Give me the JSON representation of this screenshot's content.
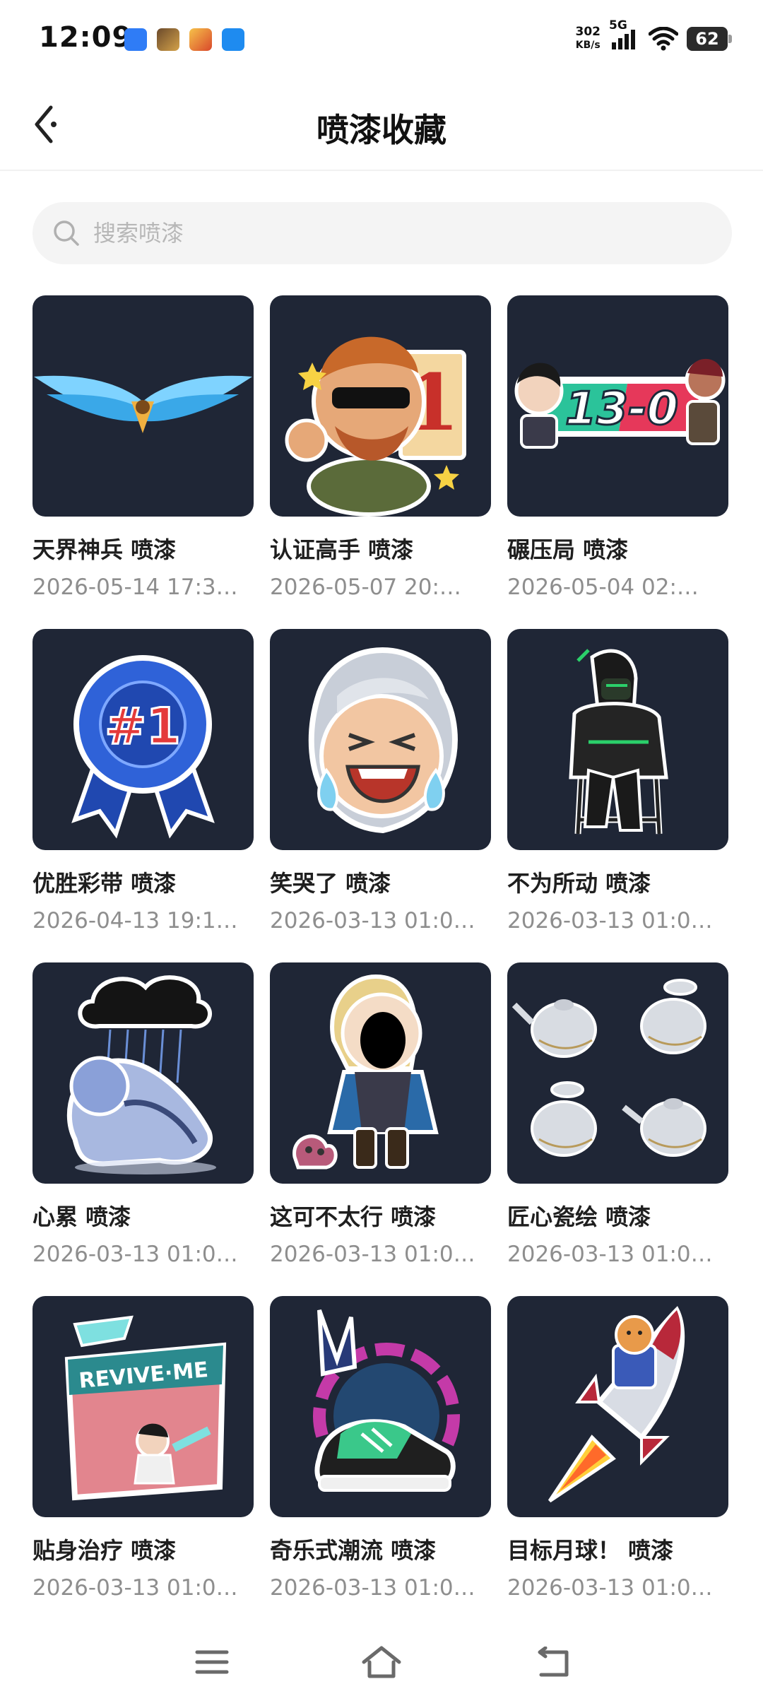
{
  "status_bar": {
    "time": "12:09",
    "speed_value": "302",
    "speed_unit": "KB/s",
    "network": "5G",
    "battery": "62"
  },
  "header": {
    "title": "喷漆收藏",
    "back_icon": "back-arrow-icon"
  },
  "search": {
    "placeholder": "搜索喷漆",
    "value": ""
  },
  "items": [
    {
      "name": "天界神兵 喷漆",
      "date": "2026-05-14 17:3…"
    },
    {
      "name": "认证高手 喷漆",
      "date": "2026-05-07 20:…"
    },
    {
      "name": "碾压局 喷漆",
      "date": "2026-05-04 02:…",
      "image_text": "13-0"
    },
    {
      "name": "优胜彩带 喷漆",
      "date": "2026-04-13 19:1…",
      "image_text": "#1"
    },
    {
      "name": "笑哭了 喷漆",
      "date": "2026-03-13 01:0…"
    },
    {
      "name": "不为所动 喷漆",
      "date": "2026-03-13 01:0…"
    },
    {
      "name": "心累 喷漆",
      "date": "2026-03-13 01:0…"
    },
    {
      "name": "这可不太行 喷漆",
      "date": "2026-03-13 01:0…"
    },
    {
      "name": "匠心瓷绘 喷漆",
      "date": "2026-03-13 01:0…"
    },
    {
      "name": "贴身治疗 喷漆",
      "date": "2026-03-13 01:0…",
      "image_text": "REVIVE·ME"
    },
    {
      "name": "奇乐式潮流 喷漆",
      "date": "2026-03-13 01:0…"
    },
    {
      "name": "目标月球！ 喷漆",
      "date": "2026-03-13 01:0…"
    }
  ],
  "colors": {
    "thumb_bg": "#1f2636",
    "name_text": "#1f1f1f",
    "date_text": "#8e8e8e",
    "search_bg": "#f4f4f4"
  },
  "nav_bar": {
    "menu_icon": "menu-icon",
    "home_icon": "home-icon",
    "back_icon": "back-icon"
  }
}
